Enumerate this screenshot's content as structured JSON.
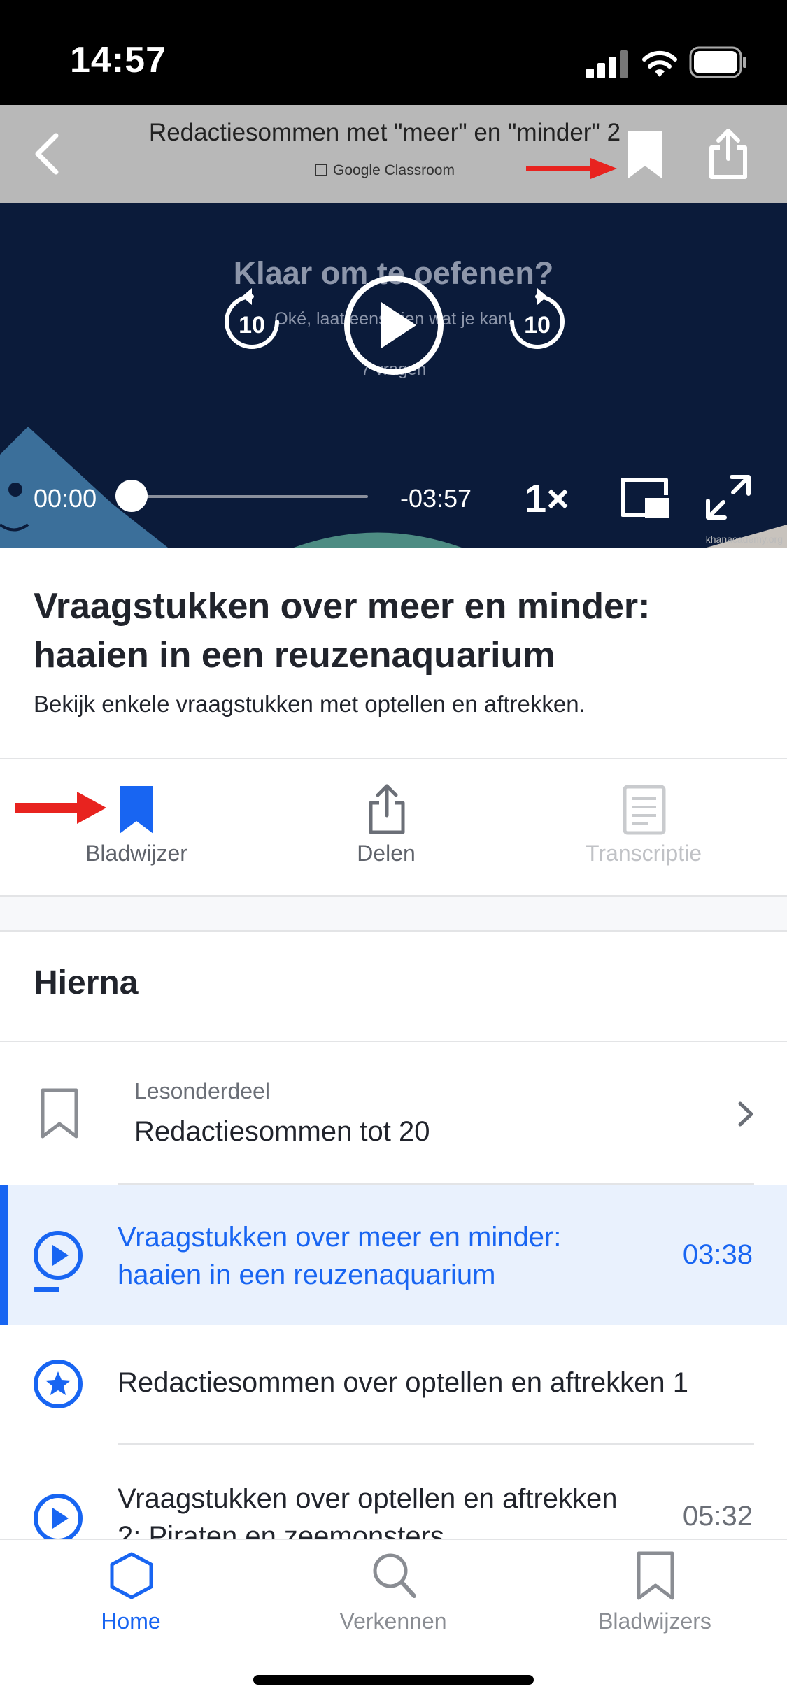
{
  "status_bar": {
    "time": "14:57"
  },
  "top_bar": {
    "title": "Redactiesommen met \"meer\" en \"minder\" 2",
    "subtitle": "Google Classroom"
  },
  "video": {
    "slide_title": "Klaar om te oefenen?",
    "slide_subtitle": "Oké, laat eens zien wat je kan!",
    "slide_count": "7 vragen",
    "skip_back_label": "10",
    "skip_forward_label": "10",
    "elapsed": "00:00",
    "remaining": "-03:57",
    "speed": "1×",
    "progress": 0,
    "watermark": "khanacademy.org"
  },
  "content": {
    "title": "Vraagstukken over meer en minder: haaien in een reuzenaquarium",
    "description": "Bekijk enkele vraagstukken met optellen en aftrekken."
  },
  "actions": {
    "bookmark": "Bladwijzer",
    "share": "Delen",
    "transcript": "Transcriptie"
  },
  "up_next": {
    "heading": "Hierna",
    "unit": {
      "kicker": "Lesonderdeel",
      "title": "Redactiesommen tot 20"
    },
    "items": [
      {
        "title_line1": "Vraagstukken over meer en minder:",
        "title_line2": "haaien in een reuzenaquarium",
        "duration": "03:38",
        "icon": "play-icon",
        "current": true
      },
      {
        "title_line1": "Redactiesommen over optellen en aftrekken 1",
        "title_line2": "",
        "duration": "",
        "icon": "star-exercise-icon",
        "current": false
      },
      {
        "title_line1": "Vraagstukken over optellen en aftrekken",
        "title_line2": "2: Piraten en zeemonsters",
        "duration": "05:32",
        "icon": "play-icon",
        "current": false
      }
    ]
  },
  "tab_bar": {
    "home": "Home",
    "explore": "Verkennen",
    "bookmarks": "Bladwijzers"
  },
  "colors": {
    "accent": "#1865f2",
    "annotation_arrow": "#e8231f",
    "video_bg": "#0b1b3a",
    "top_bar_bg": "#b8b8b8"
  }
}
